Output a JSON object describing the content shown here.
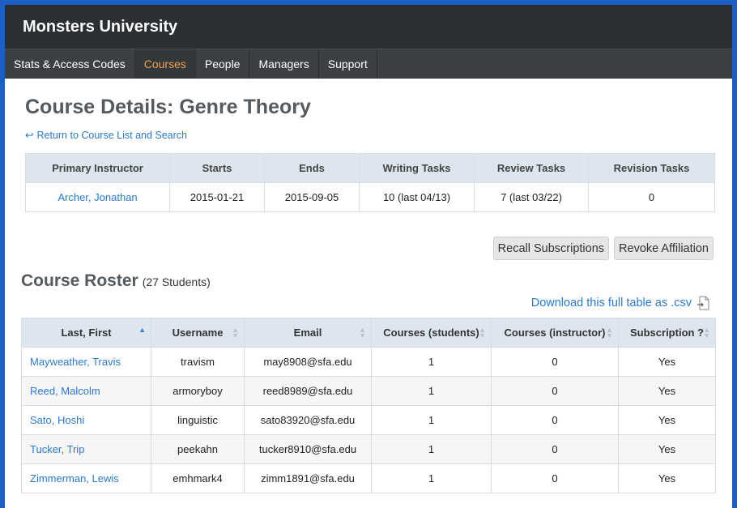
{
  "app": {
    "title": "Monsters University"
  },
  "nav": {
    "items": [
      {
        "label": "Stats & Access Codes"
      },
      {
        "label": "Courses"
      },
      {
        "label": "People"
      },
      {
        "label": "Managers"
      },
      {
        "label": "Support"
      }
    ]
  },
  "page": {
    "title": "Course Details: Genre Theory",
    "back_link": "Return to Course List and Search"
  },
  "details": {
    "headers": [
      "Primary Instructor",
      "Starts",
      "Ends",
      "Writing Tasks",
      "Review Tasks",
      "Revision Tasks"
    ],
    "row": [
      "Archer, Jonathan",
      "2015-01-21",
      "2015-09-05",
      "10 (last 04/13)",
      "7 (last 03/22)",
      "0"
    ]
  },
  "actions": {
    "recall": "Recall Subscriptions",
    "revoke": "Revoke Affiliation"
  },
  "roster": {
    "title": "Course Roster",
    "count": "(27 Students)",
    "download": "Download this full table as .csv",
    "headers": [
      "Last, First",
      "Username",
      "Email",
      "Courses (students)",
      "Courses (instructor)",
      "Subscription ?"
    ],
    "rows": [
      [
        "Mayweather, Travis",
        "travism",
        "may8908@sfa.edu",
        "1",
        "0",
        "Yes"
      ],
      [
        "Reed, Malcolm",
        "armoryboy",
        "reed8989@sfa.edu",
        "1",
        "0",
        "Yes"
      ],
      [
        "Sato, Hoshi",
        "linguistic",
        "sato83920@sfa.edu",
        "1",
        "0",
        "Yes"
      ],
      [
        "Tucker, Trip",
        "peekahn",
        "tucker8910@sfa.edu",
        "1",
        "0",
        "Yes"
      ],
      [
        "Zimmerman, Lewis",
        "emhmark4",
        "zimm1891@sfa.edu",
        "1",
        "0",
        "Yes"
      ]
    ]
  },
  "colors": {
    "accent": "#f0a04b",
    "link": "#2a7ad4",
    "header_bg": "#2b2f31",
    "nav_bg": "#3b4043",
    "table_header_bg": "#dde5ef"
  }
}
